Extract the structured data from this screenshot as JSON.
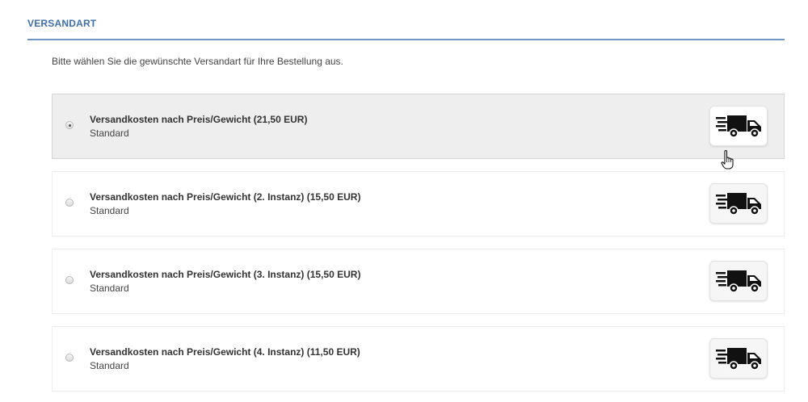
{
  "section": {
    "title": "VERSANDART",
    "intro": "Bitte wählen Sie die gewünschte Versandart für Ihre Bestellung aus."
  },
  "options": [
    {
      "title": "Versandkosten nach Preis/Gewicht (21,50 EUR)",
      "subtitle": "Standard",
      "selected": true,
      "icon": "delivery-truck-icon"
    },
    {
      "title": "Versandkosten nach Preis/Gewicht (2. Instanz) (15,50 EUR)",
      "subtitle": "Standard",
      "selected": false,
      "icon": "delivery-truck-icon"
    },
    {
      "title": "Versandkosten nach Preis/Gewicht (3. Instanz) (15,50 EUR)",
      "subtitle": "Standard",
      "selected": false,
      "icon": "delivery-truck-icon"
    },
    {
      "title": "Versandkosten nach Preis/Gewicht (4. Instanz) (11,50 EUR)",
      "subtitle": "Standard",
      "selected": false,
      "icon": "delivery-truck-icon"
    }
  ],
  "colors": {
    "accent": "#3f6fa8",
    "rule": "#6e95c4",
    "selected_bg": "#eeeeee"
  },
  "cursor_icon": "hand-pointer-icon"
}
